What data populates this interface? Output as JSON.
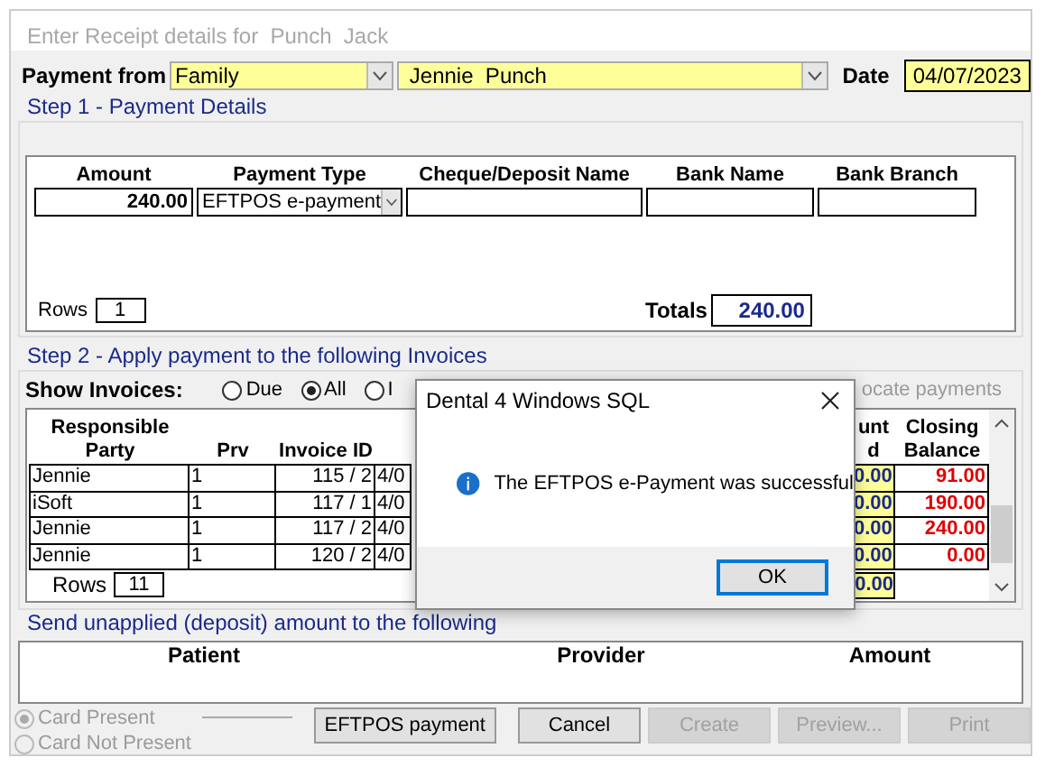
{
  "window": {
    "title": "Enter Receipt details for  Punch  Jack"
  },
  "payment_from": {
    "label": "Payment from",
    "type": "Family",
    "payer": "Jennie  Punch",
    "date_label": "Date",
    "date": "04/07/2023"
  },
  "step1": {
    "title": "Step 1 - Payment Details",
    "columns": [
      "Amount",
      "Payment Type",
      "Cheque/Deposit Name",
      "Bank Name",
      "Bank Branch"
    ],
    "rows": [
      {
        "amount": "240.00",
        "payment_type": "EFTPOS e-payment"
      }
    ],
    "rows_label": "Rows",
    "rows_count": "1",
    "totals_label": "Totals",
    "total": "240.00"
  },
  "step2": {
    "title": "Step 2 - Apply payment to the following Invoices",
    "show_label": "Show Invoices:",
    "filters": [
      {
        "label": "Due",
        "selected": false
      },
      {
        "label": "All",
        "selected": true
      },
      {
        "label": "I",
        "selected": false
      }
    ],
    "allocate_label": "ocate payments",
    "columns": [
      "Responsible Party",
      "Prv",
      "Invoice ID",
      "unt\nd",
      "Closing Balance"
    ],
    "rows": [
      {
        "party": "Jennie",
        "prv": "1",
        "invoice_id": "115 / 2",
        "date": "4/0",
        "paid": "0.00",
        "closing": "91.00"
      },
      {
        "party": "iSoft",
        "prv": "1",
        "invoice_id": "117 / 1",
        "date": "4/0",
        "paid": "0.00",
        "closing": "190.00"
      },
      {
        "party": "Jennie",
        "prv": "1",
        "invoice_id": "117 / 2",
        "date": "4/0",
        "paid": "0.00",
        "closing": "240.00"
      },
      {
        "party": "Jennie",
        "prv": "1",
        "invoice_id": "120 / 2",
        "date": "4/0",
        "paid": "0.00",
        "closing": "0.00"
      }
    ],
    "rows_label": "Rows",
    "rows_count": "11",
    "paid_total": "0.00"
  },
  "deposit": {
    "title": "Send unapplied (deposit) amount to the following",
    "columns": [
      "Patient",
      "Provider",
      "Amount"
    ]
  },
  "card_options": [
    {
      "label": "Card Present",
      "selected": true,
      "disabled": true
    },
    {
      "label": "Card Not Present",
      "selected": false,
      "disabled": true
    }
  ],
  "buttons": [
    {
      "label": "EFTPOS payment",
      "disabled": false
    },
    {
      "label": "Cancel",
      "disabled": false
    },
    {
      "label": "Create",
      "disabled": true
    },
    {
      "label": "Preview...",
      "disabled": true
    },
    {
      "label": "Print",
      "disabled": true
    }
  ],
  "dialog": {
    "title": "Dental 4 Windows SQL",
    "message": "The EFTPOS e-Payment was successful",
    "button": "OK"
  }
}
